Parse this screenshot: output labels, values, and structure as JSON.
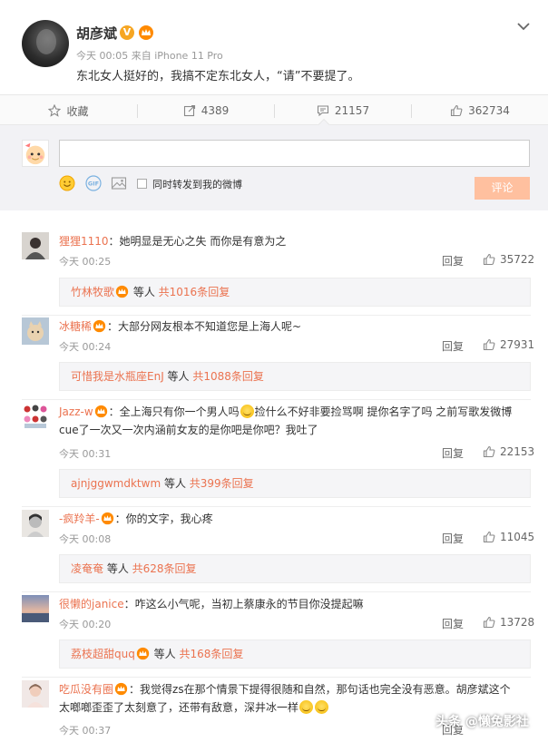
{
  "post": {
    "author": "胡彦斌",
    "v_badge": "V",
    "meta": "今天 00:05 来自 iPhone 11 Pro",
    "text": "东北女人挺好的，我搞不定东北女人，“请”不要提了。"
  },
  "actions": {
    "favorite": "收藏",
    "repost": "4389",
    "comment": "21157",
    "like": "362734"
  },
  "composer": {
    "input_value": "",
    "forward_label": "同时转发到我的微博",
    "submit_label": "评论"
  },
  "comments": [
    {
      "user": "狸狸1110",
      "text": "：她明显是无心之失  而你是有意为之",
      "time": "今天 00:25",
      "reply": "回复",
      "likes": "35722",
      "sub_user": "竹林牧歌",
      "sub_mid": " 等人 ",
      "sub_more": "共1016条回复"
    },
    {
      "user": "冰糖稀",
      "text": "：大部分网友根本不知道您是上海人呢~",
      "time": "今天 00:24",
      "reply": "回复",
      "likes": "27931",
      "sub_user": "可惜我是水瓶座EnJ",
      "sub_mid": " 等人 ",
      "sub_more": "共1088条回复"
    },
    {
      "user": "Jazz-w",
      "text_a": "：全上海只有你一个男人吗",
      "text_b": "捡什么不好非要捡骂啊 提你名字了吗 之前写歌发微博",
      "text_line2": "cue了一次又一次内涵前女友的是你吧是你吧？我吐了",
      "time": "今天 00:31",
      "reply": "回复",
      "likes": "22153",
      "sub_user": "ajnjggwmdktwm",
      "sub_mid": " 等人 ",
      "sub_more": "共399条回复"
    },
    {
      "user": "-疯羚羊-",
      "text": "：你的文字，我心疼",
      "time": "今天 00:08",
      "reply": "回复",
      "likes": "11045",
      "sub_user": "凌奄奄",
      "sub_mid": " 等人 ",
      "sub_more": "共628条回复"
    },
    {
      "user": "很懒的janice",
      "text": "：咋这么小气呢，当初上蔡康永的节目你没提起嘛",
      "time": "今天 00:20",
      "reply": "回复",
      "likes": "13728",
      "sub_user": "荔枝超甜quq",
      "sub_mid": " 等人 ",
      "sub_more": "共168条回复"
    },
    {
      "user": "吃瓜没有圈",
      "text_line1": "：我觉得zs在那个情景下提得很随和自然，那句话也完全没有恶意。胡彦斌这个",
      "text_line2": "太啷啷歪歪了太刻意了，还带有敌意，深井冰一样",
      "time": "今天 00:37",
      "reply": "回复"
    }
  ],
  "watermark": "头条 @懒兔影社",
  "colors": {
    "accent": "#eb7350",
    "submit_disabled": "#ffc09f",
    "vip": "#f6a623"
  }
}
